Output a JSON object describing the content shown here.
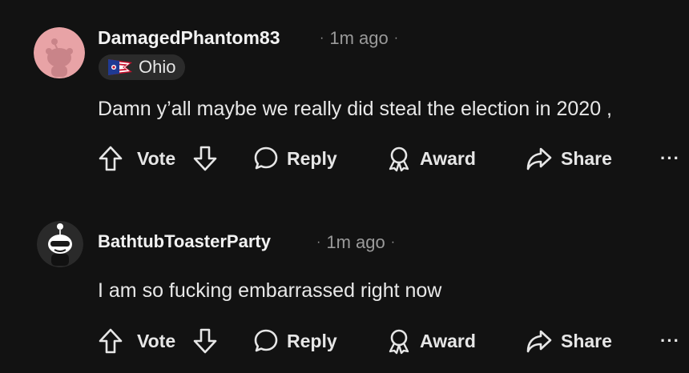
{
  "comments": [
    {
      "username": "DamagedPhantom83",
      "time": "1m ago",
      "flair": "Ohio",
      "body": "Damn y’all maybe we really did steal the election in 2020 ,",
      "actions": {
        "vote": "Vote",
        "reply": "Reply",
        "award": "Award",
        "share": "Share",
        "more": "···"
      }
    },
    {
      "username": "BathtubToasterParty",
      "time": "1m ago",
      "body": "I am so fucking embarrassed right now",
      "actions": {
        "vote": "Vote",
        "reply": "Reply",
        "award": "Award",
        "share": "Share",
        "more": "···"
      }
    }
  ],
  "separator": "·",
  "icons": [
    "snoo-avatar-icon",
    "ohio-flag-icon",
    "upvote-arrow-icon",
    "downvote-arrow-icon",
    "reply-bubble-icon",
    "award-ribbon-icon",
    "share-arrow-icon",
    "more-dots-icon"
  ],
  "colors": {
    "background": "#121212",
    "text": "#e8e8e8",
    "meta": "#9a9a9a",
    "flair_bg": "#2b2b2b",
    "avatar1": "#e8a3a6"
  }
}
